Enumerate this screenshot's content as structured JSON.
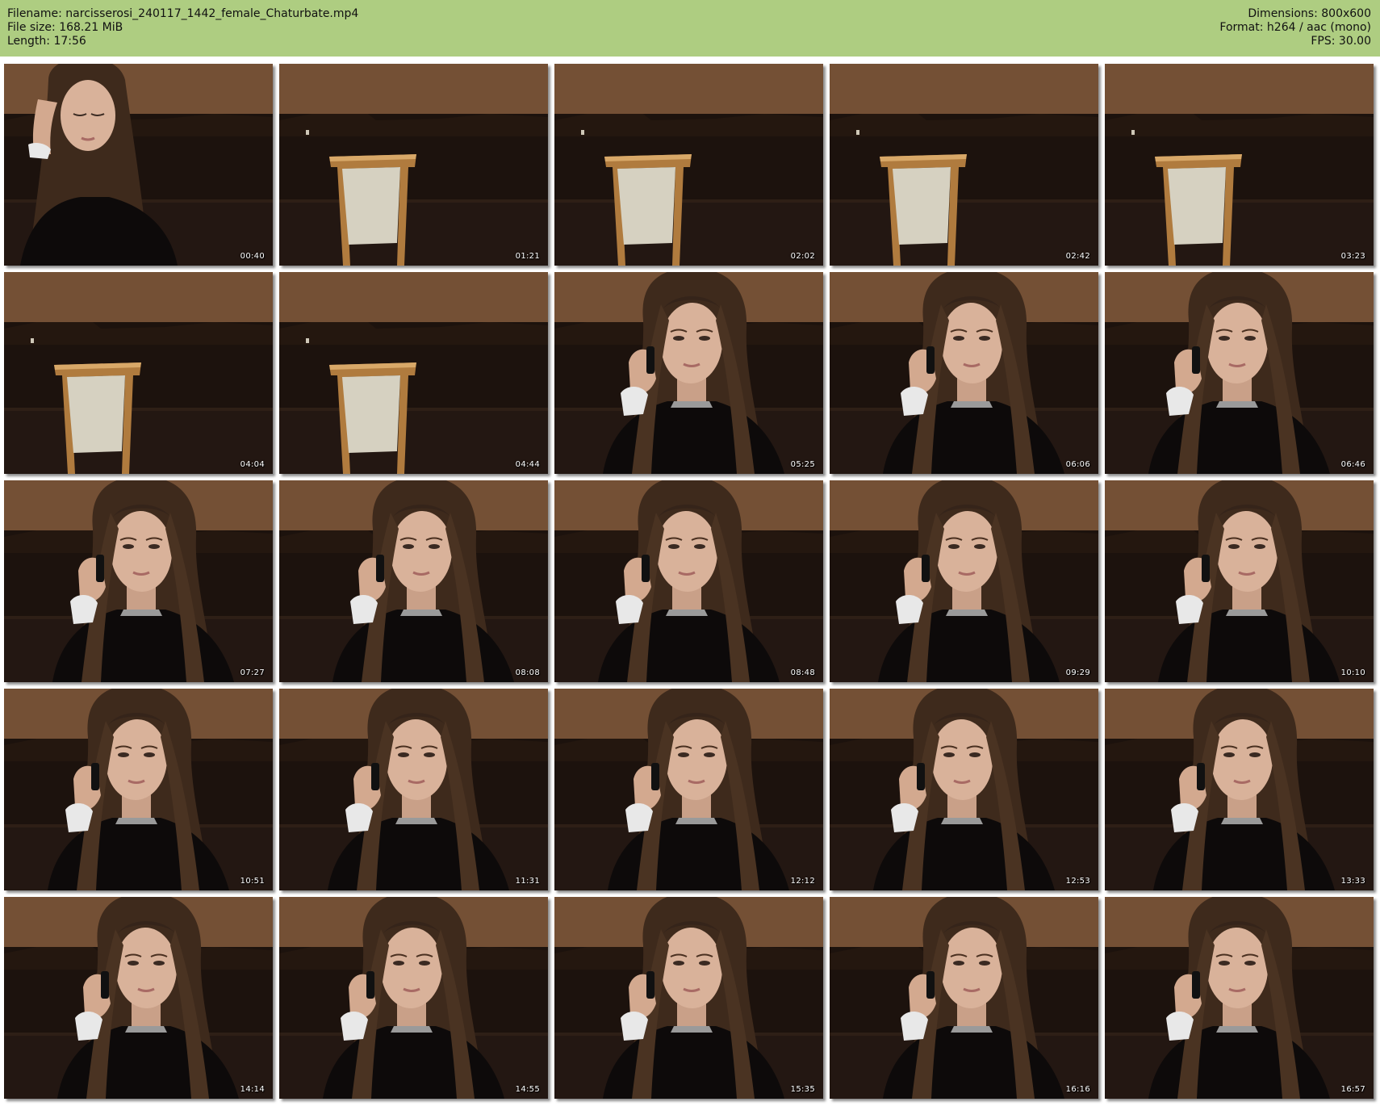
{
  "header": {
    "filename_label": "Filename: narcisserosi_240117_1442_female_Chaturbate.mp4",
    "filesize_label": "File size: 168.21 MiB",
    "length_label": "Length: 17:56",
    "dimensions_label": "Dimensions: 800x600",
    "format_label": "Format: h264 / aac (mono)",
    "fps_label": "FPS: 30.00"
  },
  "colors": {
    "header_bg": "#aecd81",
    "wall": "#7a5538",
    "sofa": "#1c120d",
    "floor": "#231712",
    "hair": "#3e2a1c",
    "skin": "#d9b29a",
    "sweater": "#0d0a0a",
    "chair_frame": "#b07b3e",
    "chair_back": "#d6d1c1"
  },
  "thumbnails": [
    {
      "time": "00:40",
      "scene": "woman-looking-down"
    },
    {
      "time": "01:21",
      "scene": "empty-chair"
    },
    {
      "time": "02:02",
      "scene": "empty-chair"
    },
    {
      "time": "02:42",
      "scene": "empty-chair"
    },
    {
      "time": "03:23",
      "scene": "empty-chair"
    },
    {
      "time": "04:04",
      "scene": "empty-chair"
    },
    {
      "time": "04:44",
      "scene": "empty-chair"
    },
    {
      "time": "05:25",
      "scene": "woman-on-phone"
    },
    {
      "time": "06:06",
      "scene": "woman-on-phone"
    },
    {
      "time": "06:46",
      "scene": "woman-on-phone"
    },
    {
      "time": "07:27",
      "scene": "woman-on-phone"
    },
    {
      "time": "08:08",
      "scene": "woman-on-phone"
    },
    {
      "time": "08:48",
      "scene": "woman-on-phone"
    },
    {
      "time": "09:29",
      "scene": "woman-on-phone"
    },
    {
      "time": "10:10",
      "scene": "woman-on-phone"
    },
    {
      "time": "10:51",
      "scene": "woman-on-phone"
    },
    {
      "time": "11:31",
      "scene": "woman-on-phone"
    },
    {
      "time": "12:12",
      "scene": "woman-on-phone"
    },
    {
      "time": "12:53",
      "scene": "woman-on-phone"
    },
    {
      "time": "13:33",
      "scene": "woman-on-phone"
    },
    {
      "time": "14:14",
      "scene": "woman-on-phone"
    },
    {
      "time": "14:55",
      "scene": "woman-on-phone"
    },
    {
      "time": "15:35",
      "scene": "woman-on-phone"
    },
    {
      "time": "16:16",
      "scene": "woman-on-phone"
    },
    {
      "time": "16:57",
      "scene": "woman-on-phone"
    }
  ]
}
